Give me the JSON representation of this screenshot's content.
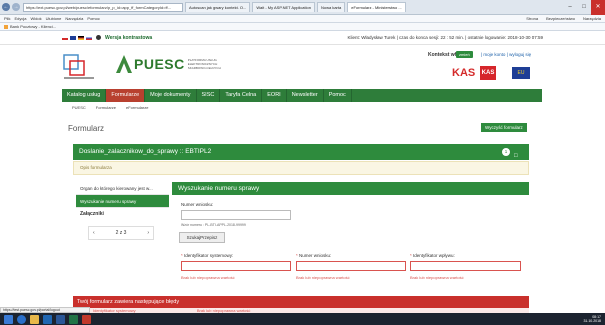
{
  "browser": {
    "url": "https://ext.puesc.gov.pl/web/puesc/eformularz/p_p_id=app_ff_formCategoryId=ff...",
    "tabs": [
      "Autoscan jak gwary kontekt. O...",
      "Wait - My ASP.NET Application",
      "Nowa karta",
      "eFormularz - Ministerstwo ..."
    ],
    "menu": [
      "Plik",
      "Edycja",
      "Widok",
      "Ulubione",
      "Narzędzia",
      "Pomoc"
    ],
    "menu_right": [
      "Strona",
      "Bezpieczeństwo",
      "Narzędzia"
    ],
    "favorite": "Bank Pocztowy - Klienci..."
  },
  "utility": {
    "version": "Wersja kontrastowa",
    "session": "Klient: Władysław Turek | czas do konca sesji: 22 : 52 min. | ostatnie logowanie: 2018-10-30 07:59"
  },
  "header": {
    "puesc_word": "PUESC",
    "puesc_sub": "PLATFORMA USŁUG ELEKTRONICZNYCH SKARBOWO-CELNYCH",
    "kontekst": "Kontekst własny",
    "zmien": "zmień",
    "acct_links": "| moje konto | wyloguj się",
    "logo_red1": "KAS",
    "logo_red2": "KAS",
    "logo_eu": "EU"
  },
  "nav": [
    "Katalog usług",
    "Formularze",
    "Moje dokumenty",
    "SISC",
    "Taryfa Celna",
    "EORI",
    "Newsletter",
    "Pomoc"
  ],
  "breadcrumb": [
    "PUESC",
    "Formularze",
    "eFormularze"
  ],
  "form": {
    "title": "Formularz",
    "clear_btn": "Wyczyść formularz",
    "doc_title": "Doslanie_zalacznikow_do_sprawy :: EBTIPL2",
    "doc_count": "1",
    "opis": "Opis formularza"
  },
  "sidebar": {
    "items": [
      "Organ do którego kierowany jest w...",
      "Wyszukanie numeru sprawy",
      "Załączniki"
    ],
    "pager": "2 z 3"
  },
  "panel": {
    "title": "Wyszukanie numeru sprawy",
    "wniosek_label": "Numer wniosku:",
    "wniosek_hint": "Wzór numeru : PL-BTI-APPL-2018-99999",
    "search_btn": "SzukajPrzepisz",
    "f1_label": "Identyfikator systemowy:",
    "f2_label": "Numer wniosku:",
    "f3_label": "Identyfikator wpływu:",
    "err_msg": "Brak lub niepoprawna wartość"
  },
  "errors": {
    "bar": "Twój formularz zawiera następujące błędy",
    "sub": "Identyfikator systemowy",
    "sub2": "Brak lub niepoprawna wartość"
  },
  "status": {
    "url": "https://test.puesc.gov.pl/portal/logout"
  },
  "tray": {
    "time": "08:17",
    "date": "31.10.2018"
  }
}
